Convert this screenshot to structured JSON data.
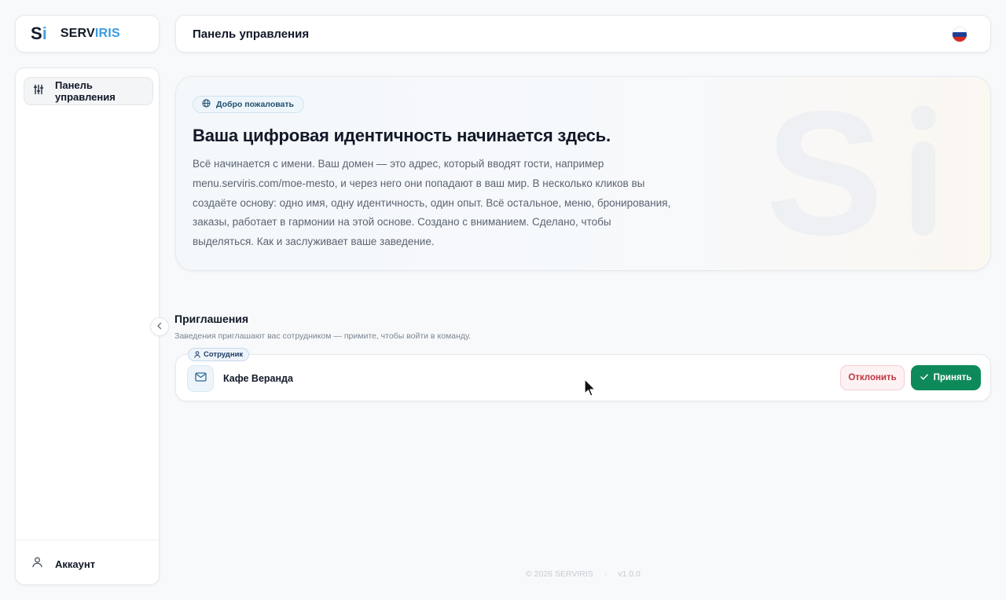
{
  "brand": {
    "mark_s": "S",
    "mark_i": "i",
    "name_prefix": "SERV",
    "name_accent": "IRIS"
  },
  "sidebar": {
    "items": [
      {
        "label": "Панель управления",
        "icon": "sliders-icon"
      }
    ],
    "account_label": "Аккаунт"
  },
  "header": {
    "title": "Панель управления",
    "language_flag": "russia-flag-icon"
  },
  "hero": {
    "badge": "Добро пожаловать",
    "title": "Ваша цифровая идентичность начинается здесь.",
    "text": "Всё начинается с имени. Ваш домен — это адрес, который вводят гости, например menu.serviris.com/moe-mesto, и через него они попадают в ваш мир. В несколько кликов вы создаёте основу: одно имя, одну идентичность, один опыт. Всё остальное, меню, бронирования, заказы, работает в гармонии на этой основе. Создано с вниманием. Сделано, чтобы выделяться. Как и заслуживает ваше заведение."
  },
  "invitations": {
    "title": "Приглашения",
    "subtitle": "Заведения приглашают вас сотрудником — примите, чтобы войти в команду.",
    "items": [
      {
        "role": "Сотрудник",
        "venue": "Кафе Веранда",
        "decline_label": "Отклонить",
        "accept_label": "Принять"
      }
    ]
  },
  "footer": {
    "copyright": "© 2026 SERVIRIS",
    "separator": "·",
    "version": "v1.0.0"
  },
  "colors": {
    "accent_blue": "#3b9be0",
    "accept_green": "#0e8a5a",
    "decline_red": "#c0363f"
  }
}
